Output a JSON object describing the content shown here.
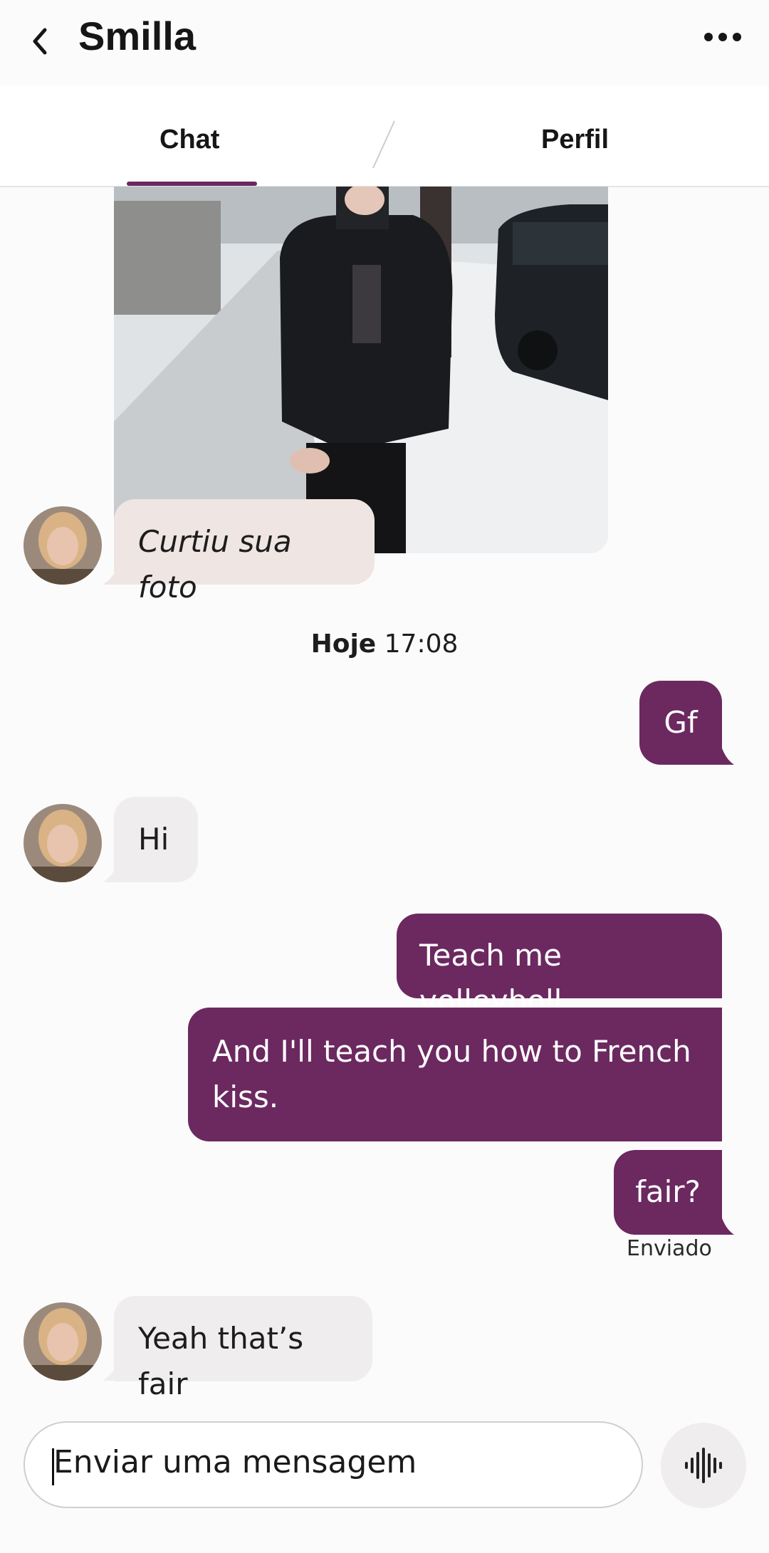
{
  "header": {
    "title": "Smilla",
    "back_icon": "chevron-left-icon",
    "more_icon": "more-horizontal-icon"
  },
  "tabs": [
    {
      "label": "Chat",
      "active": true
    },
    {
      "label": "Perfil",
      "active": false
    }
  ],
  "colors": {
    "accent": "#6b2960",
    "incoming_bubble": "#efeded",
    "like_bubble": "#efe5e2",
    "background": "#fcfbfb"
  },
  "messages": {
    "like_note": "Curtiu sua foto",
    "date_day": "Hoje",
    "date_time": "17:08",
    "out_1": "Gf",
    "in_1": "Hi",
    "out_2": "Teach me volleyboll",
    "out_3": "And I'll teach you how to French kiss.",
    "out_4": "fair?",
    "status": "Enviado",
    "in_2": "Yeah that’s fair"
  },
  "composer": {
    "placeholder": "Enviar uma mensagem",
    "voice_icon": "voice-waveform-icon"
  }
}
